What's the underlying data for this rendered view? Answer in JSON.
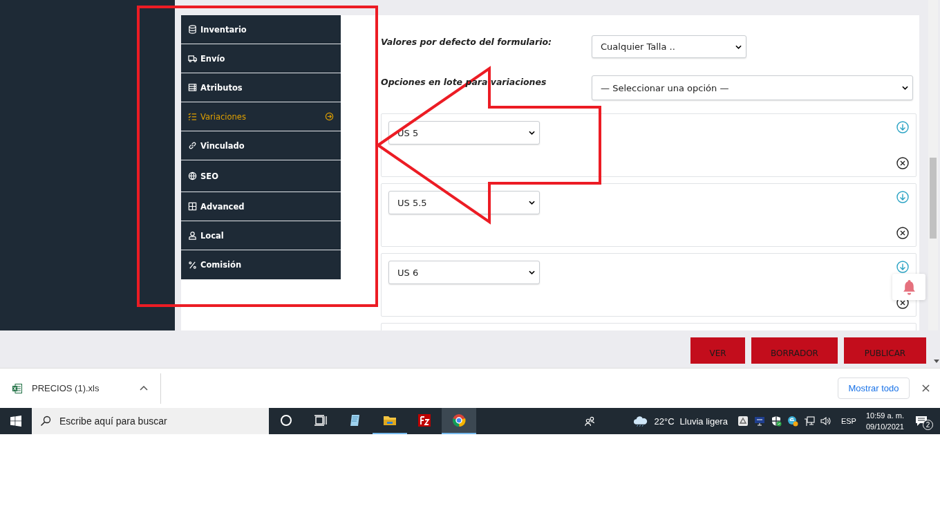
{
  "sidebar": {
    "items": [
      {
        "label": "Inventario",
        "kind": "database",
        "selected": false
      },
      {
        "label": "Envío",
        "kind": "truck",
        "selected": false
      },
      {
        "label": "Atributos",
        "kind": "list",
        "selected": false
      },
      {
        "label": "Variaciones",
        "kind": "checklist",
        "selected": true
      },
      {
        "label": "Vinculado",
        "kind": "link",
        "selected": false
      },
      {
        "label": "SEO",
        "kind": "globe",
        "selected": false
      },
      {
        "label": "Advanced",
        "kind": "grid",
        "selected": false
      },
      {
        "label": "Local",
        "kind": "user",
        "selected": false
      },
      {
        "label": "Comisión",
        "kind": "percent",
        "selected": false
      }
    ]
  },
  "form": {
    "defaults_label": "Valores por defecto del formulario:",
    "defaults_select": "Cualquier Talla ..",
    "bulk_label": "Opciones en lote para variaciones",
    "bulk_select": "— Seleccionar una opción —"
  },
  "variations": [
    {
      "size": "US 5"
    },
    {
      "size": "US 5.5"
    },
    {
      "size": "US 6"
    }
  ],
  "actions": [
    "VER",
    "BORRADOR",
    "PUBLICAR"
  ],
  "download_bar": {
    "file": "PRECIOS (1).xls",
    "show_all": "Mostrar todo"
  },
  "taskbar": {
    "search_placeholder": "Escribe aquí para buscar",
    "apps": [
      {
        "kind": "cortana",
        "running": false,
        "selected": false
      },
      {
        "kind": "taskview",
        "running": false,
        "selected": false
      },
      {
        "kind": "notepad",
        "running": false,
        "selected": false
      },
      {
        "kind": "explorer",
        "running": true,
        "selected": false
      },
      {
        "kind": "filezilla",
        "running": false,
        "selected": false
      },
      {
        "kind": "chrome",
        "running": true,
        "selected": true
      }
    ],
    "temperature": "22°C",
    "weather": "Lluvia ligera",
    "language": "ESP",
    "time": "10:59 a. m.",
    "date": "09/10/2021",
    "notifications": "2"
  }
}
